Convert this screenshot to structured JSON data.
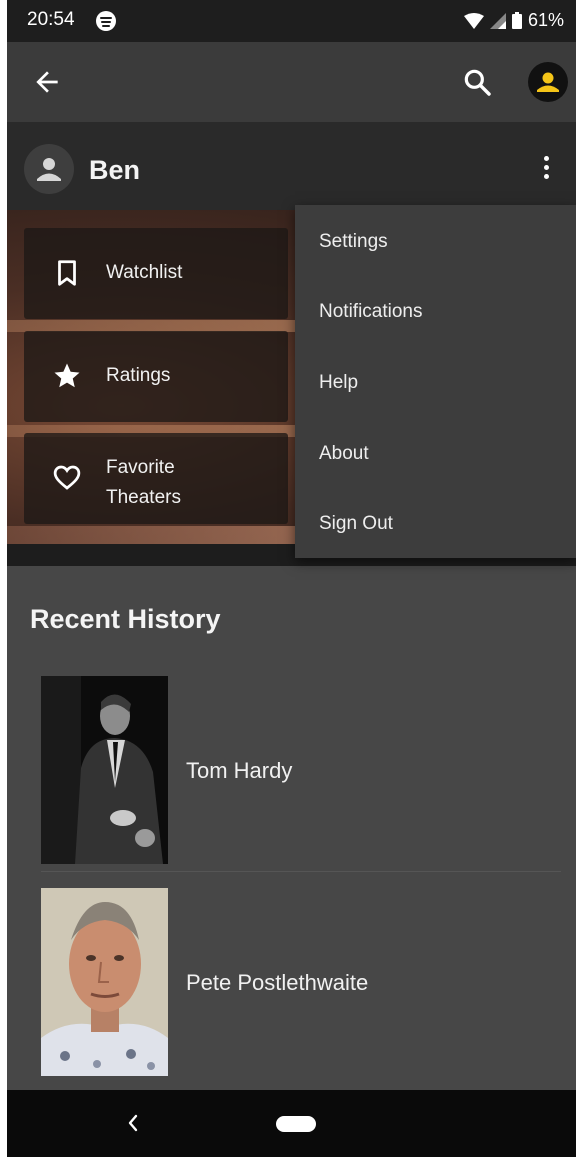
{
  "status_bar": {
    "time": "20:54",
    "battery": "61%",
    "icons": [
      "spotify-icon",
      "wifi-icon",
      "signal-icon",
      "battery-icon"
    ]
  },
  "app_bar": {
    "icons": [
      "back-arrow-icon",
      "search-icon",
      "account-icon"
    ],
    "accent": "#f5c518"
  },
  "profile": {
    "name": "Ben"
  },
  "tiles": [
    {
      "label": "Watchlist",
      "icon": "bookmark-icon"
    },
    {
      "label": "Ratings",
      "icon": "star-icon"
    },
    {
      "label_line1": "Favorite",
      "label_line2": "Theaters",
      "icon": "heart-icon"
    }
  ],
  "menu": {
    "items": [
      "Settings",
      "Notifications",
      "Help",
      "About",
      "Sign Out"
    ]
  },
  "recent": {
    "title": "Recent History",
    "items": [
      {
        "name": "Tom Hardy"
      },
      {
        "name": "Pete Postlethwaite"
      }
    ]
  }
}
